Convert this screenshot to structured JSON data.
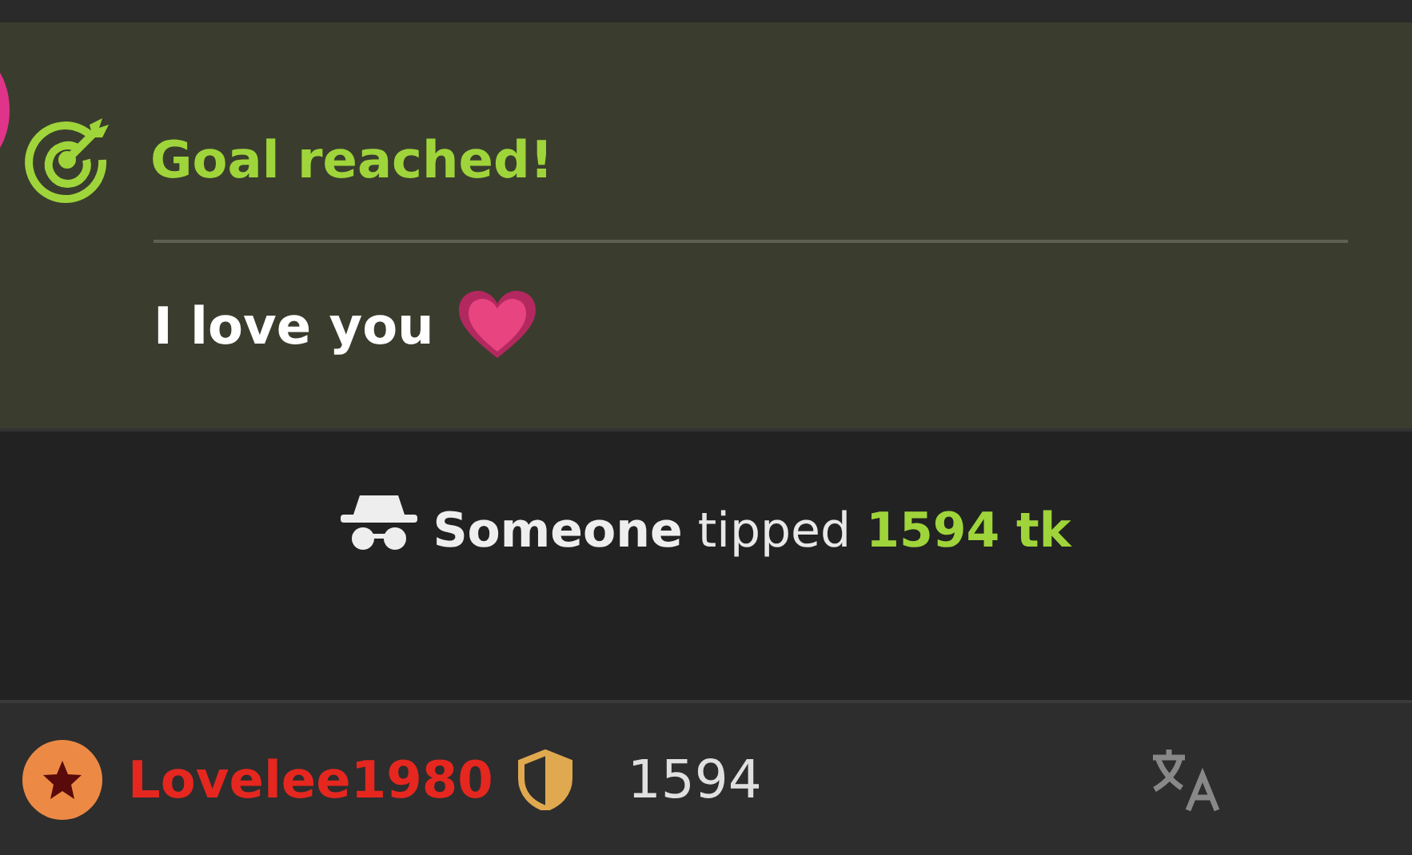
{
  "goal": {
    "title": "Goal reached!",
    "message": "I love you"
  },
  "tip": {
    "sender": "Someone",
    "verb": "tipped",
    "amount": "1594 tk"
  },
  "user_row": {
    "username": "Lovelee1980",
    "amount": "1594"
  }
}
